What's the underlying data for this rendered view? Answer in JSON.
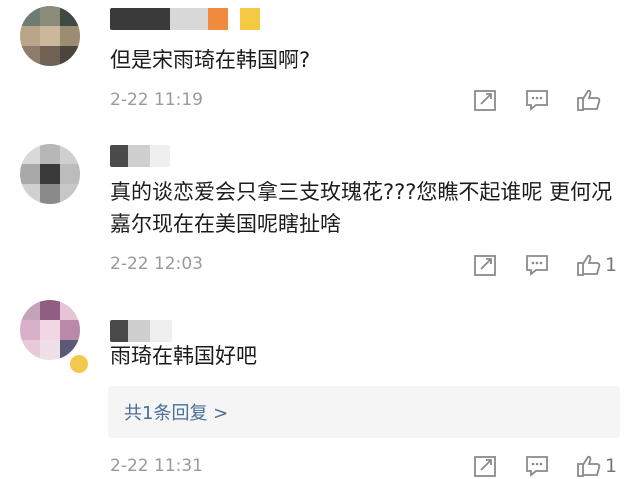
{
  "comments": [
    {
      "text": "但是宋雨琦在韩国啊?",
      "time": "2-22 11:19",
      "likes": "",
      "avatar_colors": [
        "#6f7c73",
        "#8b8b7a",
        "#3e4a44",
        "#b9a58a",
        "#cbb79b",
        "#9b8c72",
        "#8e7d6a",
        "#6f6254",
        "#4d453d"
      ]
    },
    {
      "text": "真的谈恋爱会只拿三支玫瑰花???您瞧不起谁呢 更何况嘉尔现在在美国呢瞎扯啥",
      "time": "2-22 12:03",
      "likes": "1",
      "avatar_colors": [
        "#d9d9d9",
        "#b7b7b7",
        "#cfcfcf",
        "#a9a9a9",
        "#3a3a3a",
        "#bcbcbc",
        "#d0d0d0",
        "#8a8a8a",
        "#c7c7c7"
      ]
    },
    {
      "text": "雨琦在韩国好吧",
      "time": "2-22 11:31",
      "likes": "1",
      "avatar_colors": [
        "#c3a3b9",
        "#8e5f80",
        "#e6c4d6",
        "#d8b0c9",
        "#f0d7e3",
        "#b98aa7",
        "#e9c9d7",
        "#efe0e7",
        "#5a5a78"
      ],
      "reply_link": "共1条回复 >"
    }
  ],
  "icons": {
    "repost": "repost-icon",
    "comment": "comment-icon",
    "like": "like-icon"
  },
  "colors": {
    "text": "#1c1c1c",
    "meta": "#9a9a9a",
    "link": "#4a6f9a",
    "reply_bg": "#f5f5f5"
  }
}
